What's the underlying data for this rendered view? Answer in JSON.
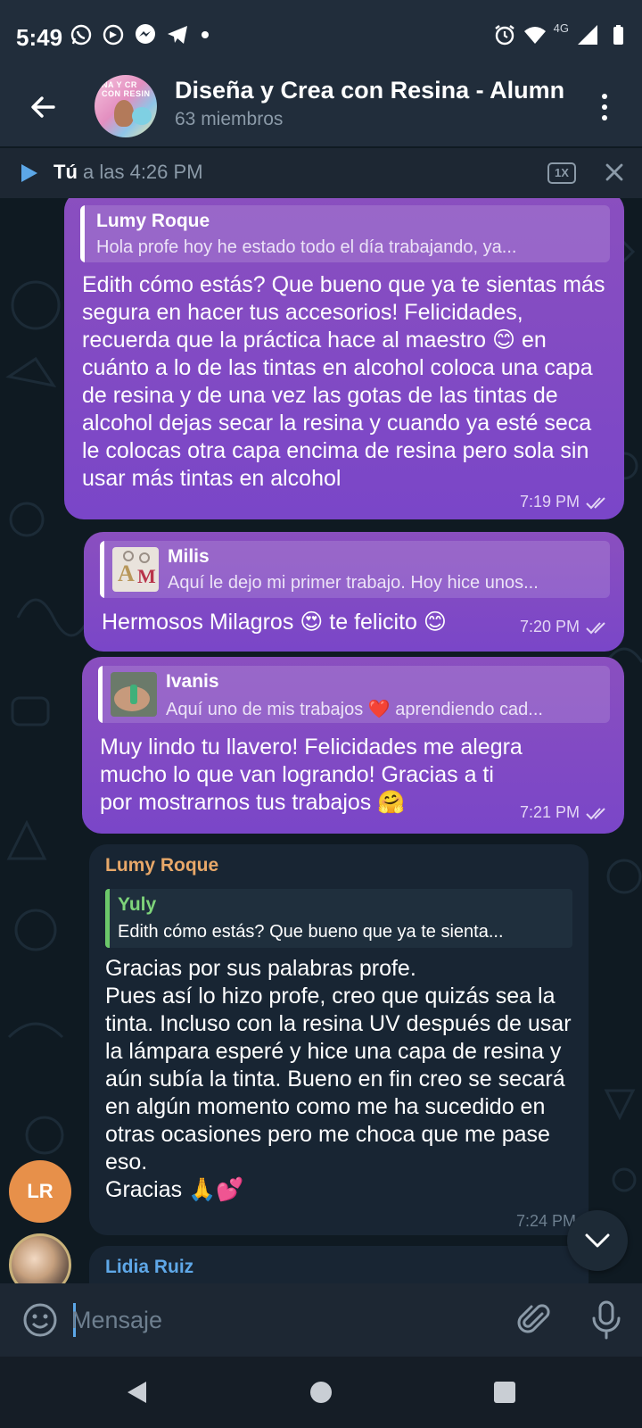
{
  "status_bar": {
    "time": "5:49",
    "network": "4G"
  },
  "header": {
    "title": "Diseña y Crea con Resina - Alumn",
    "subtitle": "63 miembros",
    "avatar_text": "ÑA Y CR\nCON RESIN"
  },
  "player": {
    "author": "Tú",
    "time_text": " a las 4:26 PM",
    "speed": "1X"
  },
  "messages": [
    {
      "reply_name": "Lumy Roque",
      "reply_text": "Hola profe hoy he estado todo el día trabajando, ya...",
      "text": "Edith cómo estás? Que bueno que ya te sientas más segura en hacer tus accesorios! Felicidades, recuerda que la práctica hace al maestro 😊 en cuánto a lo de las tintas en alcohol coloca una capa de resina y de una vez las gotas de las tintas de alcohol dejas secar la resina y cuando ya esté seca le colocas otra capa encima de resina pero sola sin usar más tintas en alcohol",
      "time": "7:19 PM"
    },
    {
      "reply_name": "Milis",
      "reply_text": "Aquí le dejo mi primer trabajo. Hoy hice unos...",
      "text": "Hermosos Milagros 😍 te felicito 😊",
      "time": "7:20 PM"
    },
    {
      "reply_name": "Ivanis",
      "reply_text": "Aquí uno de mis trabajos ❤️ aprendiendo cad...",
      "text": "Muy lindo tu llavero! Felicidades me alegra mucho lo que van logrando! Gracias a ti por mostrarnos tus trabajos 🤗",
      "time": "7:21 PM"
    },
    {
      "sender": "Lumy Roque",
      "sender_initials": "LR",
      "reply_name": "Yuly",
      "reply_text": "Edith cómo estás? Que bueno que ya te sienta...",
      "text": "Gracias por sus palabras profe.\nPues así lo hizo profe, creo que quizás sea la tinta. Incluso con la resina UV después de usar la lámpara esperé y hice una capa de resina y aún subía la tinta. Bueno en fin creo se secará en algún momento como me ha sucedido en otras ocasiones pero me choca que me pase eso.\nGracias 🙏💕",
      "time": "7:24 PM"
    },
    {
      "sender": "Lidia Ruiz"
    }
  ],
  "input": {
    "placeholder": "Mensaje"
  },
  "colors": {
    "header_bg": "#212d3b",
    "outgoing_bubble": "#7a46c8",
    "incoming_bubble": "#182533",
    "sender_lumy": "#e8a869",
    "sender_lidia": "#5fa8e8",
    "reply_green": "#7ed47a",
    "avatar_lr": "#e7904a"
  }
}
